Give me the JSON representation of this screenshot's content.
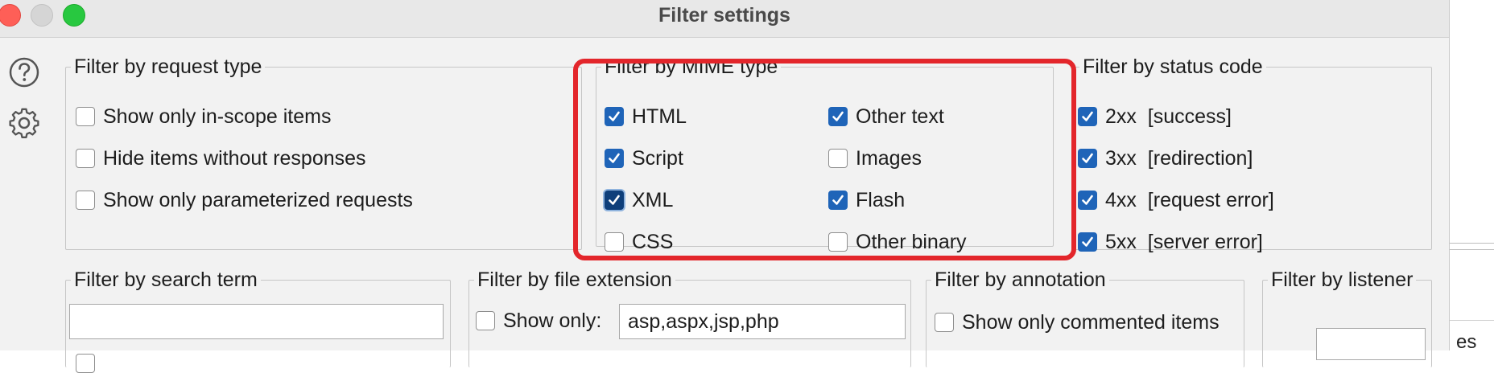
{
  "window": {
    "title": "Filter settings"
  },
  "sidebar_icons": [
    {
      "name": "help-icon"
    },
    {
      "name": "gear-icon"
    }
  ],
  "request_type": {
    "legend": "Filter by request type",
    "items": [
      {
        "label": "Show only in-scope items",
        "checked": false
      },
      {
        "label": "Hide items without responses",
        "checked": false
      },
      {
        "label": "Show only parameterized requests",
        "checked": false
      }
    ]
  },
  "mime_type": {
    "legend": "Filter by MIME type",
    "items": [
      {
        "label": "HTML",
        "checked": true
      },
      {
        "label": "Script",
        "checked": true
      },
      {
        "label": "XML",
        "checked": true
      },
      {
        "label": "CSS",
        "checked": false
      },
      {
        "label": "Other text",
        "checked": true
      },
      {
        "label": "Images",
        "checked": false
      },
      {
        "label": "Flash",
        "checked": true
      },
      {
        "label": "Other binary",
        "checked": false
      }
    ],
    "highlight_color": "#e3262b"
  },
  "status_code": {
    "legend": "Filter by status code",
    "items": [
      {
        "label": "2xx  [success]",
        "checked": true
      },
      {
        "label": "3xx  [redirection]",
        "checked": true
      },
      {
        "label": "4xx  [request error]",
        "checked": true
      },
      {
        "label": "5xx  [server error]",
        "checked": true
      }
    ]
  },
  "search_term": {
    "legend": "Filter by search term",
    "value": ""
  },
  "file_extension": {
    "legend": "Filter by file extension",
    "show_only_label": "Show only:",
    "show_only_checked": false,
    "value": "asp,aspx,jsp,php"
  },
  "annotation": {
    "legend": "Filter by annotation",
    "items": [
      {
        "label": "Show only commented items",
        "checked": false
      }
    ]
  },
  "listener": {
    "legend": "Filter by listener"
  },
  "background_fragment": "es",
  "colors": {
    "checkbox_checked": "#1f64b8",
    "window_bg": "#f2f2f2"
  }
}
